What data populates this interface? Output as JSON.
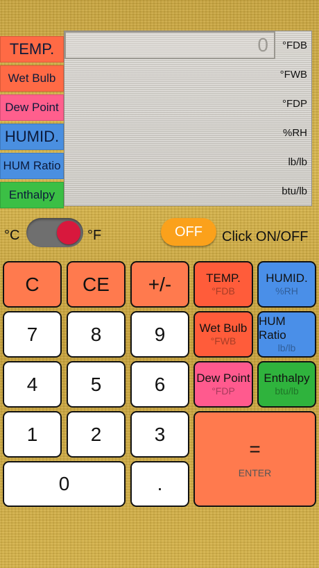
{
  "labels": [
    {
      "text": "TEMP.",
      "color": "#ff6a45"
    },
    {
      "text": "Wet Bulb",
      "color": "#ff6a45"
    },
    {
      "text": "Dew Point",
      "color": "#ff5f8d"
    },
    {
      "text": "HUMID.",
      "color": "#4a8fe0"
    },
    {
      "text": "HUM Ratio",
      "color": "#4a8fe0"
    },
    {
      "text": "Enthalpy",
      "color": "#3bbf45"
    }
  ],
  "display": {
    "value": "0",
    "units": [
      "°FDB",
      "°FWB",
      "°FDP",
      "%RH",
      "lb/lb",
      "btu/lb"
    ]
  },
  "toggle": {
    "left": "°C",
    "right": "°F",
    "state": "on"
  },
  "power": {
    "button": "OFF",
    "hint": "Click ON/OFF"
  },
  "keys": {
    "c": "C",
    "ce": "CE",
    "sign": "+/-",
    "temp": {
      "label": "TEMP.",
      "unit": "°FDB"
    },
    "humid": {
      "label": "HUMID.",
      "unit": "%RH"
    },
    "wetbulb": {
      "label": "Wet Bulb",
      "unit": "°FWB"
    },
    "humratio": {
      "label": "HUM Ratio",
      "unit": "lb/lb"
    },
    "dewpoint": {
      "label": "Dew Point",
      "unit": "°FDP"
    },
    "enthalpy": {
      "label": "Enthalpy",
      "unit": "btu/lb"
    },
    "d7": "7",
    "d8": "8",
    "d9": "9",
    "d4": "4",
    "d5": "5",
    "d6": "6",
    "d1": "1",
    "d2": "2",
    "d3": "3",
    "d0": "0",
    "dot": ".",
    "equals": {
      "label": "=",
      "sub": "ENTER"
    }
  }
}
